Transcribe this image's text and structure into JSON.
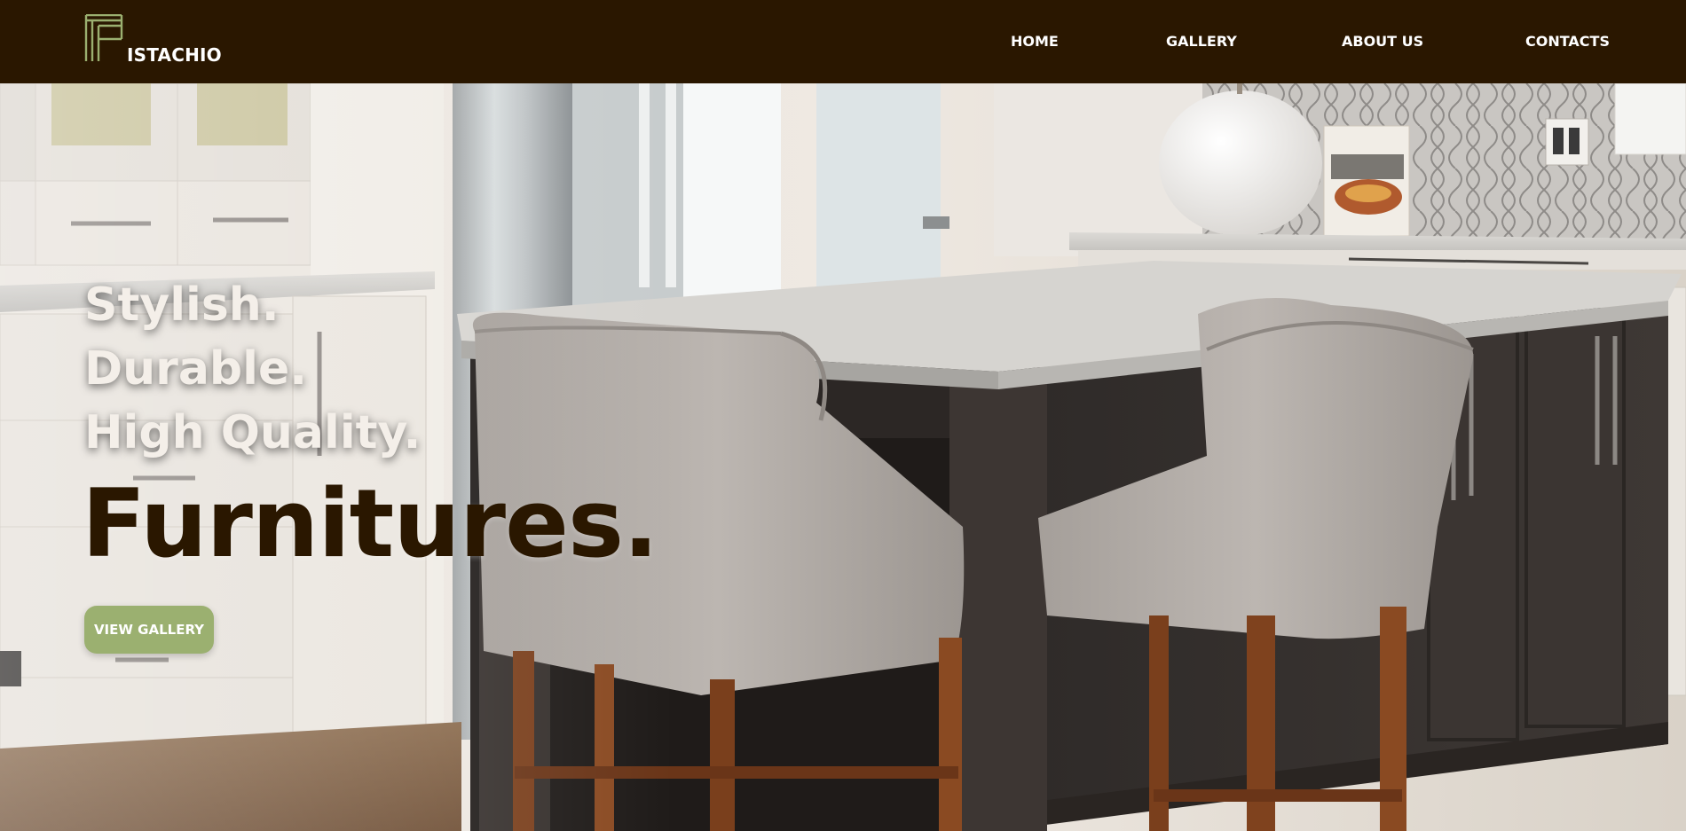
{
  "brand": {
    "name": "ISTACHIO",
    "logo_icon": "pistachio-p-logo-icon",
    "accent_color": "#9bb070",
    "header_color": "#2a1700"
  },
  "nav": {
    "items": [
      {
        "label": "HOME"
      },
      {
        "label": "GALLERY"
      },
      {
        "label": "ABOUT US"
      },
      {
        "label": "CONTACTS"
      }
    ]
  },
  "hero": {
    "lines": [
      "Stylish.",
      "Durable.",
      "High Quality."
    ],
    "headline": "Furnitures.",
    "button_label": "VIEW GALLERY",
    "image": "kitchen-island-with-bar-chairs-photo"
  }
}
